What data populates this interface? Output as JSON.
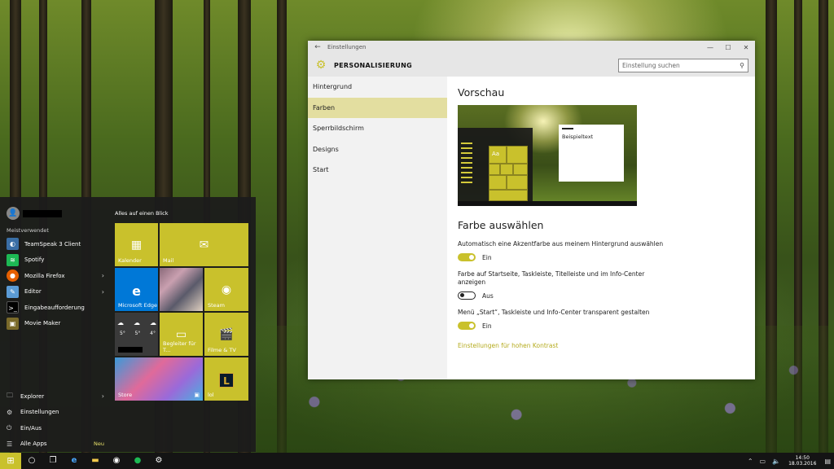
{
  "window": {
    "title": "Einstellungen",
    "controls": {
      "minimize": "—",
      "maximize": "☐",
      "close": "✕"
    },
    "back": "←",
    "header_title": "PERSONALISIERUNG",
    "search_placeholder": "Einstellung suchen",
    "nav": [
      {
        "label": "Hintergrund"
      },
      {
        "label": "Farben"
      },
      {
        "label": "Sperrbildschirm"
      },
      {
        "label": "Designs"
      },
      {
        "label": "Start"
      }
    ],
    "active_nav": "Farben",
    "content": {
      "preview_heading": "Vorschau",
      "preview_tile_label": "Aa",
      "preview_sample_text": "Beispieltext",
      "color_heading": "Farbe auswählen",
      "options": [
        {
          "label": "Automatisch eine Akzentfarbe aus meinem Hintergrund auswählen",
          "state": "Ein",
          "on": true
        },
        {
          "label": "Farbe auf Startseite, Taskleiste, Titelleiste und im Info-Center anzeigen",
          "state": "Aus",
          "on": false
        },
        {
          "label": "Menü „Start“, Taskleiste und Info-Center transparent gestalten",
          "state": "Ein",
          "on": true
        }
      ],
      "high_contrast_link": "Einstellungen für hohen Kontrast"
    }
  },
  "start_menu": {
    "most_used_label": "Meistverwendet",
    "apps": [
      {
        "label": "TeamSpeak 3 Client",
        "icon": "teamspeak-icon",
        "color": "#3a6ea5"
      },
      {
        "label": "Spotify",
        "icon": "spotify-icon",
        "color": "#1db954"
      },
      {
        "label": "Mozilla Firefox",
        "icon": "firefox-icon",
        "color": "#e66000",
        "arrow": "›"
      },
      {
        "label": "Editor",
        "icon": "notepad-icon",
        "color": "#5b9bd5",
        "arrow": "›"
      },
      {
        "label": "Eingabeaufforderung",
        "icon": "cmd-icon",
        "color": "#000000"
      },
      {
        "label": "Movie Maker",
        "icon": "movie-maker-icon",
        "color": "#7a6a2a"
      }
    ],
    "bottom": [
      {
        "label": "Explorer",
        "icon": "📁",
        "arrow": "›"
      },
      {
        "label": "Einstellungen",
        "icon": "⚙"
      },
      {
        "label": "Ein/Aus",
        "icon": "⏻"
      },
      {
        "label": "Alle Apps",
        "icon": "☰",
        "badge": "Neu"
      }
    ],
    "tiles_title": "Alles auf einen Blick",
    "tiles": {
      "kalender": "Kalender",
      "mail": "Mail",
      "edge": "Microsoft Edge",
      "steam": "Steam",
      "weather_temps": [
        "5°",
        "5°",
        "4°"
      ],
      "begleiter": "Begleiter für T...",
      "filme": "Filme & TV",
      "store": "Store",
      "lol": "lol"
    }
  },
  "taskbar": {
    "time": "14:50",
    "date": "18.03.2016"
  },
  "colors": {
    "accent": "#c9c12c",
    "start_bg": "#1c1c1c",
    "edge_tile": "#0078d7"
  }
}
